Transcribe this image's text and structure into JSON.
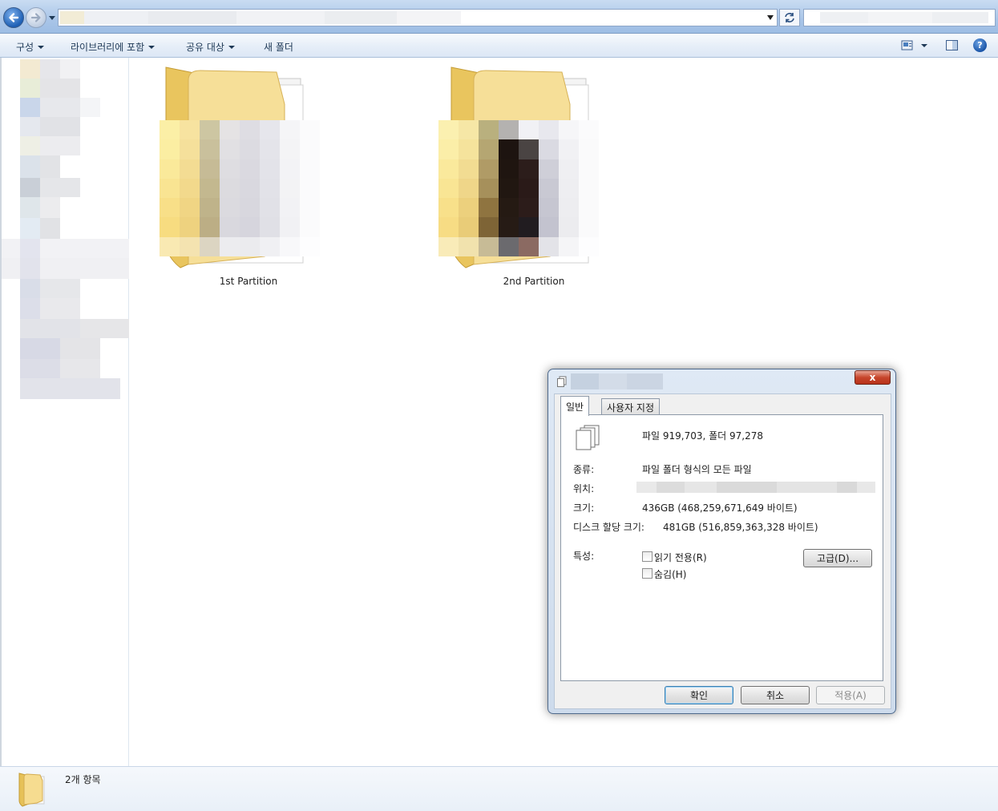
{
  "commandbar": {
    "organize": "구성",
    "include_in_library": "라이브러리에 포함",
    "share_with": "공유 대상",
    "new_folder": "새 폴더"
  },
  "folders": [
    {
      "name": "1st Partition"
    },
    {
      "name": "2nd Partition"
    }
  ],
  "statusbar": {
    "item_count": "2개 항목"
  },
  "dialog": {
    "tabs": {
      "general": "일반",
      "custom": "사용자 지정"
    },
    "summary": "파일 919,703, 폴더 97,278",
    "type_label": "종류:",
    "type_value": "파일 폴더 형식의 모든 파일",
    "location_label": "위치:",
    "size_label": "크기:",
    "size_value": "436GB (468,259,671,649 바이트)",
    "disk_size_label": "디스크 할당 크기:",
    "disk_size_value": "481GB (516,859,363,328 바이트)",
    "attributes_label": "특성:",
    "readonly_label": "읽기 전용(R)",
    "hidden_label": "숨김(H)",
    "advanced_button": "고급(D)...",
    "ok_button": "확인",
    "cancel_button": "취소",
    "apply_button": "적용(A)",
    "close_glyph": "x"
  },
  "help_glyph": "?",
  "colors": {
    "accent": "#1e5fb4",
    "close_red": "#c7462c",
    "folder_yellow": "#f2d37a"
  }
}
